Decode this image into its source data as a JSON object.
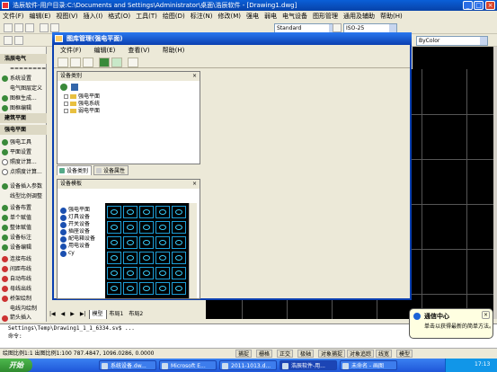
{
  "app": {
    "title": "浩辰软件-用户目录:C:\\Documents and Settings\\Administrator\\桌面\\浩辰软件 - [Drawing1.dwg]",
    "window_buttons": [
      "_",
      "□",
      "×"
    ]
  },
  "menubar": [
    "文件(F)",
    "编辑(E)",
    "视图(V)",
    "插入(I)",
    "格式(O)",
    "工具(T)",
    "绘图(D)",
    "标注(N)",
    "修改(M)",
    "强电",
    "弱电",
    "电气设备",
    "图形管理",
    "通用及辅助",
    "帮助(H)"
  ],
  "toolbar": {
    "style_combo": "Standard",
    "dim_combo": "ISO-25",
    "color_combo": "ByColor"
  },
  "leftpanel": {
    "items": [
      {
        "label": "浩辰电气",
        "kind": "header"
      },
      {
        "label": "========",
        "kind": "plain"
      },
      {
        "label": "系统设置",
        "kind": "icon"
      },
      {
        "label": "电气图层定义",
        "kind": "plain"
      },
      {
        "label": "图框生成...",
        "kind": "icon"
      },
      {
        "label": "图框编辑",
        "kind": "icon"
      },
      {
        "label": "建筑平面",
        "kind": "header"
      },
      {
        "label": "强电平面",
        "kind": "header"
      },
      {
        "label": "强电工具",
        "kind": "icon"
      },
      {
        "label": "平面设置",
        "kind": "icon"
      },
      {
        "label": "照度计算...",
        "kind": "icon"
      },
      {
        "label": "点照度计算...",
        "kind": "icon"
      },
      {
        "label": "设备插入参数",
        "kind": "icon"
      },
      {
        "label": "线型比例调整",
        "kind": "plain"
      },
      {
        "label": "设备布置",
        "kind": "icon"
      },
      {
        "label": "单个赋值",
        "kind": "icon"
      },
      {
        "label": "整体赋值",
        "kind": "icon"
      },
      {
        "label": "设备标注",
        "kind": "icon"
      },
      {
        "label": "设备编辑",
        "kind": "icon"
      },
      {
        "label": "连接布线",
        "kind": "icon"
      },
      {
        "label": "间距布线",
        "kind": "icon"
      },
      {
        "label": "自动布线",
        "kind": "icon"
      },
      {
        "label": "母线出线",
        "kind": "icon"
      },
      {
        "label": "桥架绘制",
        "kind": "icon"
      },
      {
        "label": "电线沟绘制",
        "kind": "plain"
      },
      {
        "label": "箭头插入",
        "kind": "icon"
      },
      {
        "label": "箭头旋转",
        "kind": "icon"
      },
      {
        "label": "其他布线",
        "kind": "icon"
      }
    ]
  },
  "dialog": {
    "title": "图库管理(强电平面)",
    "menu": [
      "文件(F)",
      "编辑(E)",
      "查看(V)",
      "帮助(H)"
    ],
    "category_title": "设备类别",
    "tree": [
      "强电平面",
      "强电系统",
      "弱电平面"
    ],
    "tabs": [
      "设备类别",
      "设备属性"
    ],
    "template_title": "设备模板",
    "templates": [
      "强电平面",
      "灯具设备",
      "开关设备",
      "插座设备",
      "配电箱设备",
      "用电设备",
      "cy"
    ]
  },
  "layout_tabs": [
    "|◀",
    "◀",
    "▶",
    "▶|",
    "模型",
    "布局1",
    "布局2"
  ],
  "command": {
    "lines": [
      "Settings\\Temp\\Drawing1_1_1_6334.sv$ ...",
      "命令:"
    ]
  },
  "status": {
    "coords": "绘图比例1:1 出图比例1:100  787.4847,  1096.0286,  0.0000",
    "toggles": [
      "捕捉",
      "栅格",
      "正交",
      "极轴",
      "对象捕捉",
      "对象追踪",
      "线宽",
      "模型"
    ]
  },
  "taskbar": {
    "start": "开始",
    "tasks": [
      "系统设备.dw...",
      "Microsoft E...",
      "2011-1013.d...",
      "浩辰软件-用...",
      "未命名 - 画图"
    ],
    "clock": "17:13"
  },
  "balloon": {
    "title": "通信中心",
    "message": "单击以获得最新的简单方法。"
  }
}
